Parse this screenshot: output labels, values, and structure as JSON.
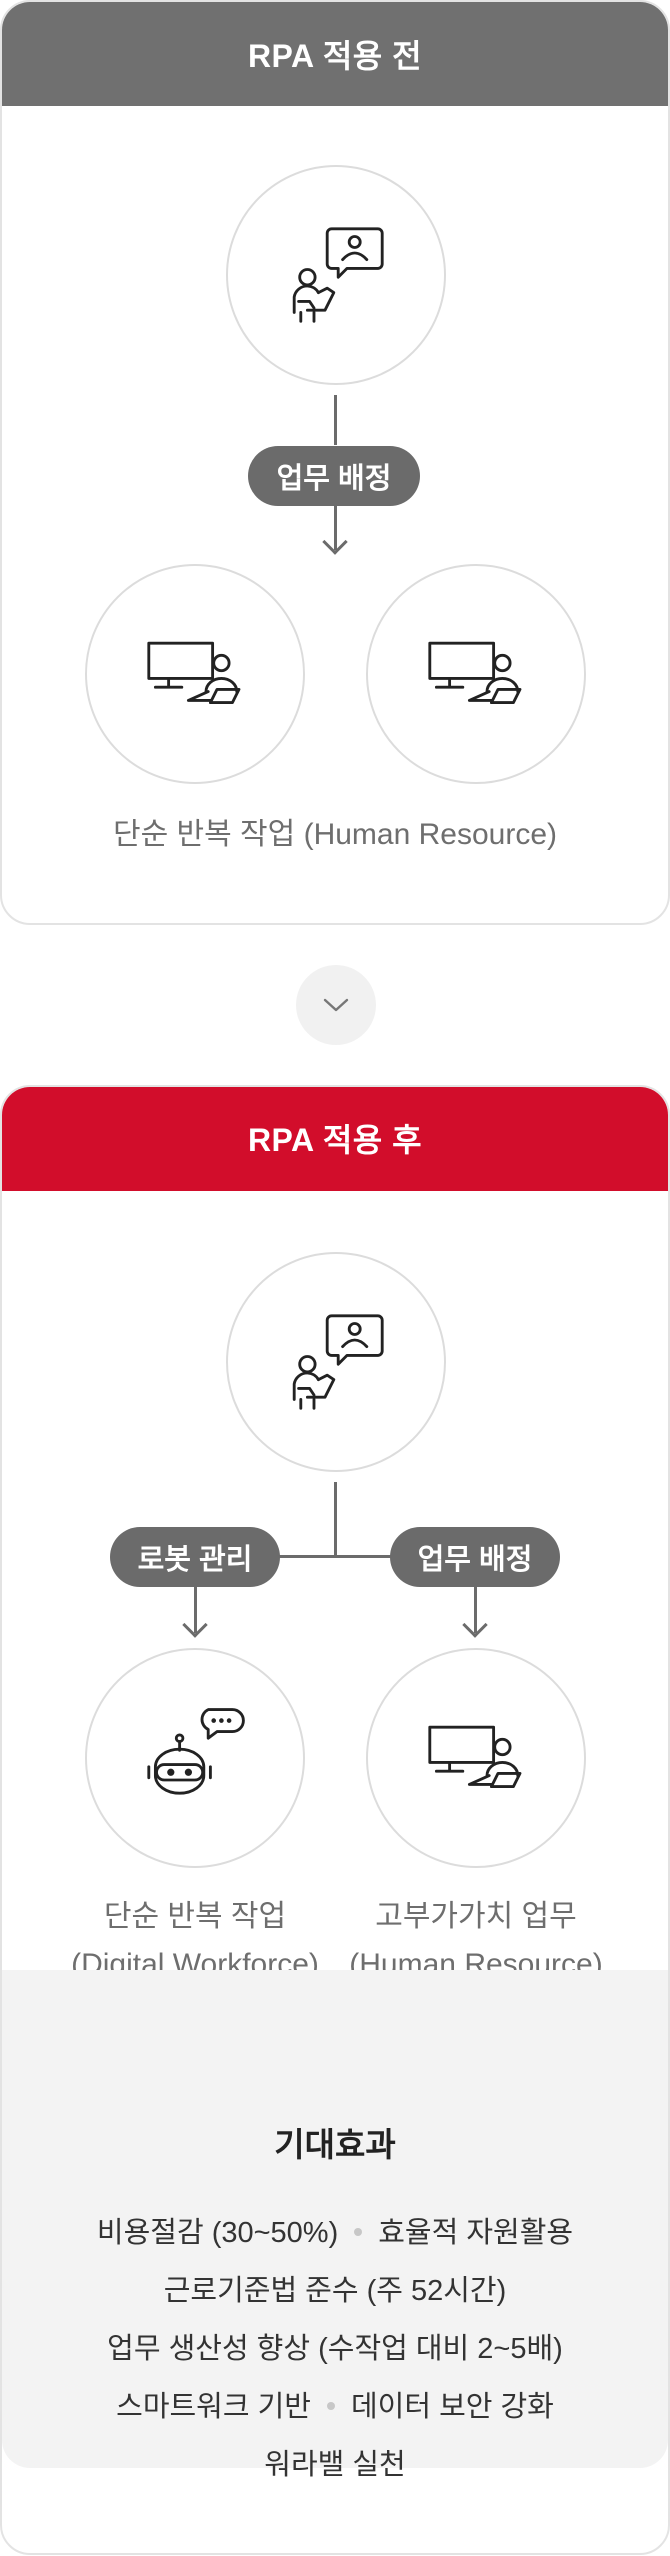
{
  "before": {
    "header": "RPA 적용 전",
    "assign_label": "업무 배정",
    "caption": "단순 반복 작업 (Human Resource)"
  },
  "after": {
    "header": "RPA 적용 후",
    "robot_label": "로봇 관리",
    "assign_label": "업무 배정",
    "left_caption_1": "단순 반복 작업",
    "left_caption_2": "(Digital Workforce)",
    "right_caption_1": "고부가가치 업무",
    "right_caption_2": "(Human Resource)"
  },
  "effects": {
    "title": "기대효과",
    "line1_a": "비용절감 (30~50%)",
    "line1_b": "효율적 자원활용",
    "line2": "근로기준법 준수 (주 52시간)",
    "line3": "업무 생산성 향상 (수작업 대비 2~5배)",
    "line4_a": "스마트워크 기반",
    "line4_b": "데이터 보안 강화",
    "line5": "워라밸 실천"
  },
  "colors": {
    "before_header": "#707070",
    "after_header": "#d20d2b",
    "pill": "#6b6b6b",
    "circle_border": "#dcdcdc",
    "effect_bg": "#f3f3f3"
  },
  "icons": {
    "manager": "manager-presenting-icon",
    "worker": "person-at-computer-icon",
    "robot": "robot-chat-icon",
    "toggle": "chevron-down-icon"
  }
}
